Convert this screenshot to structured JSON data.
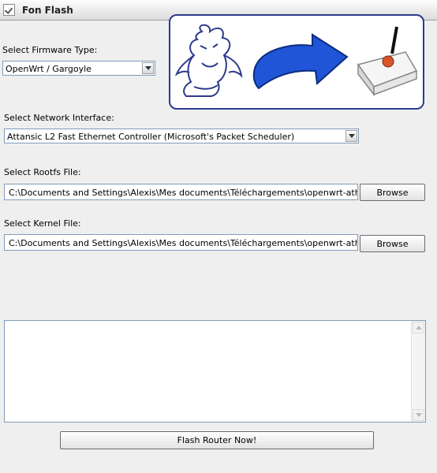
{
  "window": {
    "title": "Fon Flash"
  },
  "firmware": {
    "label": "Select Firmware Type:",
    "selected": "OpenWrt / Gargoyle"
  },
  "network": {
    "label": "Select Network Interface:",
    "selected": "Attansic L2 Fast Ethernet Controller (Microsoft's Packet Scheduler)"
  },
  "rootfs": {
    "label": "Select Rootfs File:",
    "value": "C:\\Documents and Settings\\Alexis\\Mes documents\\Téléchargements\\openwrt-atheros-root.",
    "browse_label": "Browse"
  },
  "kernel": {
    "label": "Select Kernel File:",
    "value": "C:\\Documents and Settings\\Alexis\\Mes documents\\Téléchargements\\openwrt-atheros-vmlir",
    "browse_label": "Browse"
  },
  "log": {
    "text": ""
  },
  "flash_button": {
    "label": "Flash Router Now!"
  },
  "colors": {
    "arrow": "#1f55d6",
    "banner_border": "#2d3a8c",
    "router_accent": "#d9542a"
  }
}
